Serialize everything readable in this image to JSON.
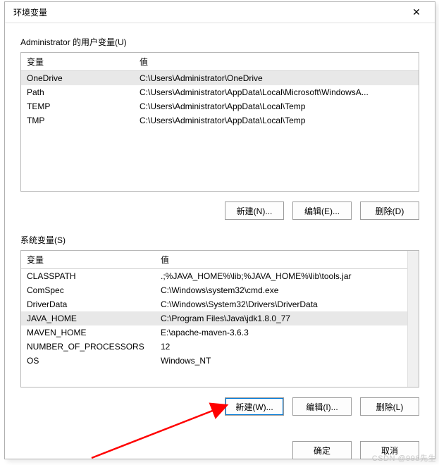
{
  "dialog": {
    "title": "环境变量",
    "close": "✕"
  },
  "user": {
    "label": "Administrator 的用户变量(U)",
    "headers": {
      "name": "变量",
      "value": "值"
    },
    "rows": [
      {
        "name": "OneDrive",
        "value": "C:\\Users\\Administrator\\OneDrive"
      },
      {
        "name": "Path",
        "value": "C:\\Users\\Administrator\\AppData\\Local\\Microsoft\\WindowsA..."
      },
      {
        "name": "TEMP",
        "value": "C:\\Users\\Administrator\\AppData\\Local\\Temp"
      },
      {
        "name": "TMP",
        "value": "C:\\Users\\Administrator\\AppData\\Local\\Temp"
      }
    ],
    "buttons": {
      "new": "新建(N)...",
      "edit": "编辑(E)...",
      "delete": "删除(D)"
    }
  },
  "system": {
    "label": "系统变量(S)",
    "headers": {
      "name": "变量",
      "value": "值"
    },
    "rows": [
      {
        "name": "CLASSPATH",
        "value": ".;%JAVA_HOME%\\lib;%JAVA_HOME%\\lib\\tools.jar"
      },
      {
        "name": "ComSpec",
        "value": "C:\\Windows\\system32\\cmd.exe"
      },
      {
        "name": "DriverData",
        "value": "C:\\Windows\\System32\\Drivers\\DriverData"
      },
      {
        "name": "JAVA_HOME",
        "value": "C:\\Program Files\\Java\\jdk1.8.0_77"
      },
      {
        "name": "MAVEN_HOME",
        "value": "E:\\apache-maven-3.6.3"
      },
      {
        "name": "NUMBER_OF_PROCESSORS",
        "value": "12"
      },
      {
        "name": "OS",
        "value": "Windows_NT"
      }
    ],
    "selected_index": 3,
    "buttons": {
      "new": "新建(W)...",
      "edit": "编辑(I)...",
      "delete": "删除(L)"
    }
  },
  "footer": {
    "ok": "确定",
    "cancel": "取消"
  },
  "watermark": "CSDN @998先生"
}
